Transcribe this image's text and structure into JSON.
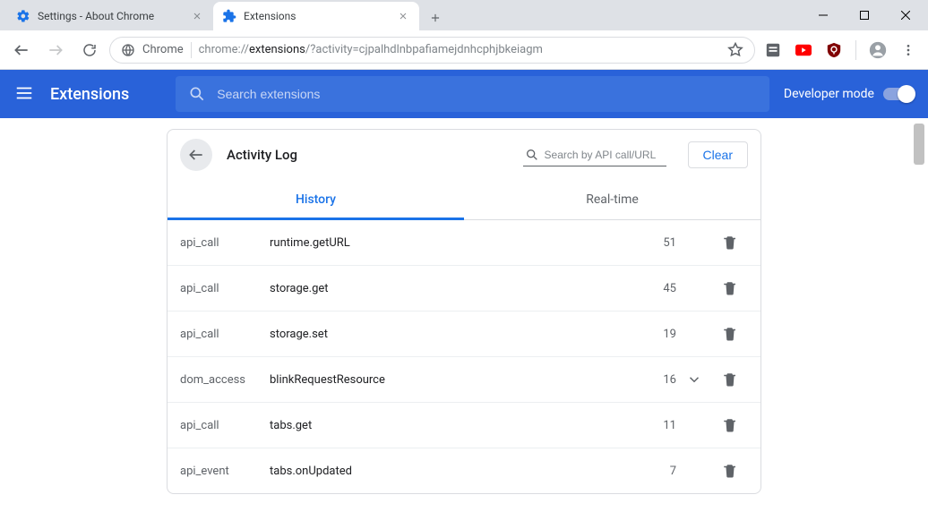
{
  "window": {
    "tabs": [
      {
        "title": "Settings - About Chrome",
        "active": false
      },
      {
        "title": "Extensions",
        "active": true
      }
    ]
  },
  "toolbar": {
    "chip": "Chrome",
    "url_prefix": "chrome://",
    "url_bold": "extensions",
    "url_suffix": "/?activity=cjpalhdlnbpafiamejdnhcphjbkeiagm"
  },
  "header": {
    "title": "Extensions",
    "search_placeholder": "Search extensions",
    "dev_mode_label": "Developer mode"
  },
  "card": {
    "title": "Activity Log",
    "api_search_placeholder": "Search by API call/URL",
    "clear_label": "Clear",
    "tabs": {
      "history": "History",
      "realtime": "Real-time",
      "active": "history"
    }
  },
  "activity_rows": [
    {
      "type": "api_call",
      "name": "runtime.getURL",
      "count": "51",
      "expandable": false
    },
    {
      "type": "api_call",
      "name": "storage.get",
      "count": "45",
      "expandable": false
    },
    {
      "type": "api_call",
      "name": "storage.set",
      "count": "19",
      "expandable": false
    },
    {
      "type": "dom_access",
      "name": "blinkRequestResource",
      "count": "16",
      "expandable": true
    },
    {
      "type": "api_call",
      "name": "tabs.get",
      "count": "11",
      "expandable": false
    },
    {
      "type": "api_event",
      "name": "tabs.onUpdated",
      "count": "7",
      "expandable": false
    }
  ]
}
